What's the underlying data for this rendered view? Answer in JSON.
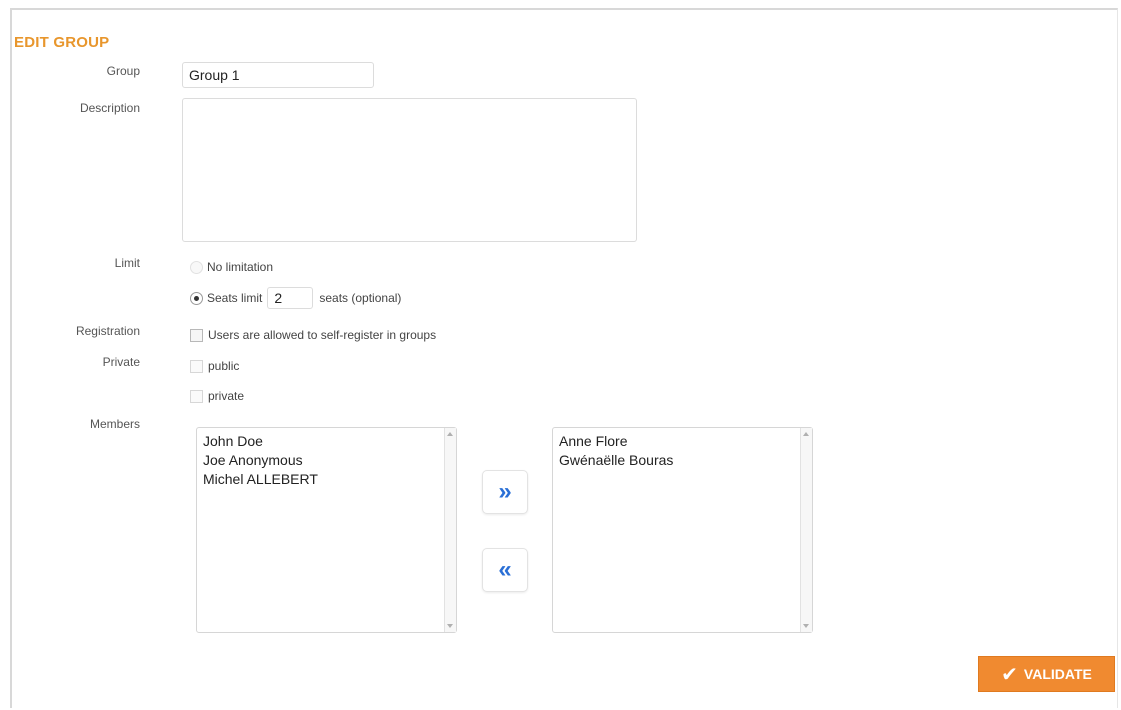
{
  "title": "EDIT GROUP",
  "group": {
    "label": "Group",
    "value": "Group 1"
  },
  "description": {
    "label": "Description",
    "value": ""
  },
  "limit": {
    "label": "Limit",
    "no_limitation": "No limitation",
    "seats_limit": "Seats limit",
    "seats_value": "2",
    "seats_suffix": "seats (optional)",
    "selected": "seats_limit"
  },
  "registration": {
    "label": "Registration",
    "checkbox_label": "Users are allowed to self-register in groups"
  },
  "private": {
    "label": "Private",
    "options": [
      "public",
      "private"
    ]
  },
  "members": {
    "label": "Members",
    "available": [
      "John Doe",
      "Joe Anonymous",
      "Michel ALLEBERT"
    ],
    "selected": [
      "Anne Flore",
      "Gwénaëlle Bouras"
    ],
    "add_icon": "double-chevron-right-icon",
    "remove_icon": "double-chevron-left-icon",
    "add_glyph": "»",
    "remove_glyph": "«"
  },
  "validate": {
    "label": "VALIDATE",
    "icon": "check-icon"
  },
  "colors": {
    "accent": "#e8962c",
    "button": "#f08a30",
    "arrow": "#2a6fd6"
  }
}
